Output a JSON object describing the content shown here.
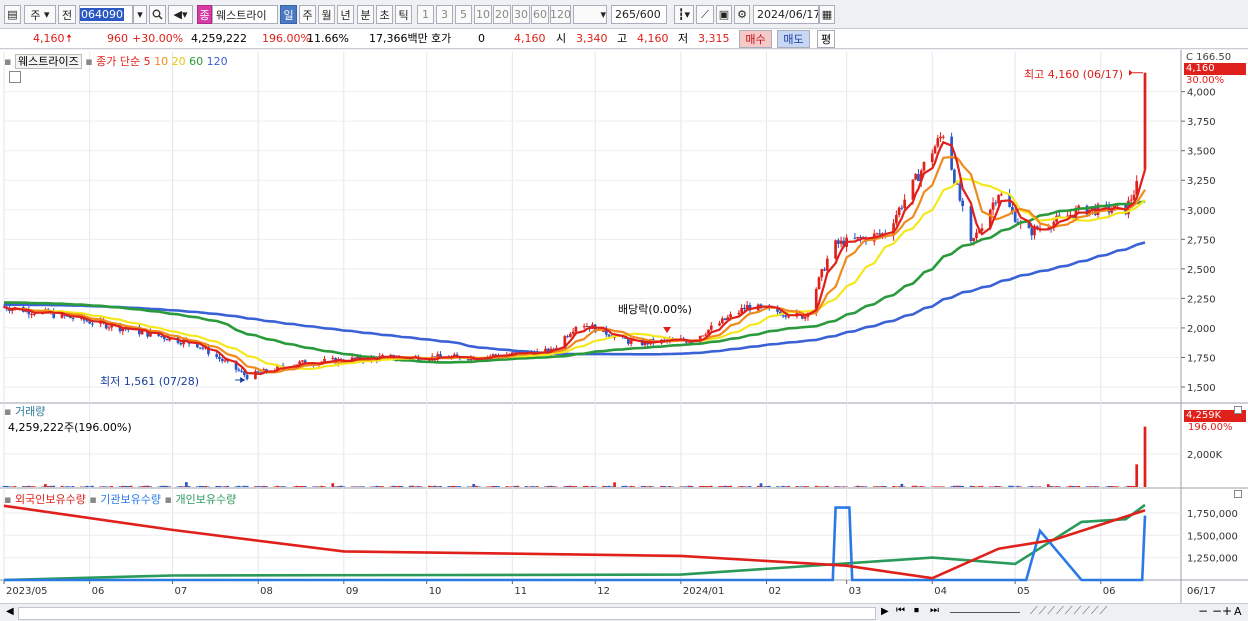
{
  "toolbar": {
    "period_type": "주",
    "prev_label": "전",
    "stock_code": "064090",
    "badge": "종",
    "stock_name": "웨스트라이",
    "tab_day": "일",
    "tab_week": "주",
    "tab_month": "월",
    "tab_year": "년",
    "tab_minute": "분",
    "tab_second": "초",
    "tab_tick": "틱",
    "intervals": [
      "1",
      "3",
      "5",
      "10",
      "20",
      "30",
      "60",
      "120"
    ],
    "count": "265",
    "count_total": "/600",
    "date": "2024/06/17"
  },
  "quote": {
    "price": "4,160",
    "change": "960",
    "change_pct": "+30.00%",
    "volume": "4,259,222",
    "volume_ratio": "196.00%",
    "turnover": "11.66%",
    "amount": "17,366백만",
    "hoga_label": "호가",
    "hoga_value": "0",
    "hoga_price": "4,160",
    "open_label": "시",
    "open": "3,340",
    "high_label": "고",
    "high": "4,160",
    "low_label": "저",
    "low": "3,315",
    "buy_btn": "매수",
    "sell_btn": "매도",
    "eval_btn": "평"
  },
  "legend": {
    "name": "웨스트라이즈",
    "ma_label": "종가 단순",
    "ma5": "5",
    "ma10": "10",
    "ma20": "20",
    "ma60": "60",
    "ma120": "120",
    "volume_title": "거래량",
    "volume_value": "4,259,222주(196.00%)",
    "foreign": "외국인보유수량",
    "institution": "기관보유수량",
    "individual": "개인보유수량"
  },
  "annotations": {
    "high": "최고 4,160 (06/17)",
    "low": "최저 1,561 (07/28)",
    "dividend": "배당락(0.00%)",
    "top_cut": "C 166.50",
    "price_tag": "4,160",
    "pct_tag": "30.00%",
    "vol_tag": "4,259K",
    "vol_pct_tag": "196.00%"
  },
  "colors": {
    "up": "#e0201a",
    "down": "#2a56c6",
    "ma5": "#e0201a",
    "ma10": "#f08a1c",
    "ma20": "#f4e81c",
    "ma60": "#2a9a3c",
    "ma120": "#3a62d6",
    "foreign": "#e0201a",
    "institution": "#2a7ae6",
    "individual": "#2a9a5a"
  },
  "chart_data": {
    "type": "candlestick",
    "price_axis_ticks": [
      "4,000",
      "3,750",
      "3,500",
      "3,250",
      "3,000",
      "2,750",
      "2,500",
      "2,250",
      "2,000",
      "1,750",
      "1,500"
    ],
    "price_range": [
      1390,
      4200
    ],
    "volume_axis_ticks": [
      "2,000K"
    ],
    "holding_axis_ticks": [
      "1,750,000",
      "1,500,000",
      "1,250,000"
    ],
    "holding_range": [
      1000000,
      1850000
    ],
    "x_labels": [
      "2023/05",
      "06",
      "07",
      "08",
      "09",
      "10",
      "11",
      "12",
      "2024/01",
      "02",
      "03",
      "04",
      "05",
      "06",
      "06/17"
    ],
    "ma_periods": [
      5,
      10,
      20,
      60,
      120
    ],
    "close_profile": [
      [
        "2023/05/01",
        2180
      ],
      [
        "2023/05/20",
        2110
      ],
      [
        "2023/06/15",
        1990
      ],
      [
        "2023/07/10",
        1860
      ],
      [
        "2023/07/28",
        1590
      ],
      [
        "2023/08/15",
        1700
      ],
      [
        "2023/09/15",
        1750
      ],
      [
        "2023/10/15",
        1750
      ],
      [
        "2023/11/15",
        1800
      ],
      [
        "2023/11/25",
        2050
      ],
      [
        "2023/12/15",
        1870
      ],
      [
        "2024/01/05",
        1900
      ],
      [
        "2024/01/25",
        2180
      ],
      [
        "2024/02/15",
        2100
      ],
      [
        "2024/02/25",
        2700
      ],
      [
        "2024/03/15",
        2800
      ],
      [
        "2024/04/01",
        3500
      ],
      [
        "2024/04/05",
        3650
      ],
      [
        "2024/04/15",
        2700
      ],
      [
        "2024/04/25",
        3150
      ],
      [
        "2024/05/05",
        2800
      ],
      [
        "2024/05/25",
        3000
      ],
      [
        "2024/06/10",
        3000
      ],
      [
        "2024/06/14",
        3200
      ],
      [
        "2024/06/17",
        4160
      ]
    ],
    "holdings": {
      "foreign": [
        [
          "2023/05",
          1830000
        ],
        [
          "2023/07",
          1560000
        ],
        [
          "2023/09",
          1320000
        ],
        [
          "2024/01",
          1270000
        ],
        [
          "2024/03",
          1160000
        ],
        [
          "2024/04",
          1020000
        ],
        [
          "2024/04/25",
          1350000
        ],
        [
          "2024/05/15",
          1450000
        ],
        [
          "2024/06/17",
          1780000
        ]
      ],
      "institution": [
        [
          "2023/05",
          1000000
        ],
        [
          "2024/02/25",
          1000000
        ],
        [
          "2024/02/26",
          1810000
        ],
        [
          "2024/03/02",
          1810000
        ],
        [
          "2024/03/03",
          1000000
        ],
        [
          "2024/05/05",
          1000000
        ],
        [
          "2024/05/10",
          1550000
        ],
        [
          "2024/05/25",
          1000000
        ],
        [
          "2024/06/16",
          1000000
        ],
        [
          "2024/06/17",
          1720000
        ]
      ],
      "individual": [
        [
          "2023/05",
          1000000
        ],
        [
          "2023/07",
          1050000
        ],
        [
          "2024/01",
          1060000
        ],
        [
          "2024/04",
          1250000
        ],
        [
          "2024/05/01",
          1180000
        ],
        [
          "2024/05/25",
          1650000
        ],
        [
          "2024/06/10",
          1680000
        ],
        [
          "2024/06/17",
          1840000
        ]
      ]
    }
  },
  "bottom": {
    "left_arrow": "◀",
    "right_arrow": "▶",
    "buttons": [
      "⏮",
      "⏹",
      "⏭"
    ],
    "zoom_out": "−",
    "zoom_in": "+",
    "minus": "−",
    "auto": "A"
  }
}
